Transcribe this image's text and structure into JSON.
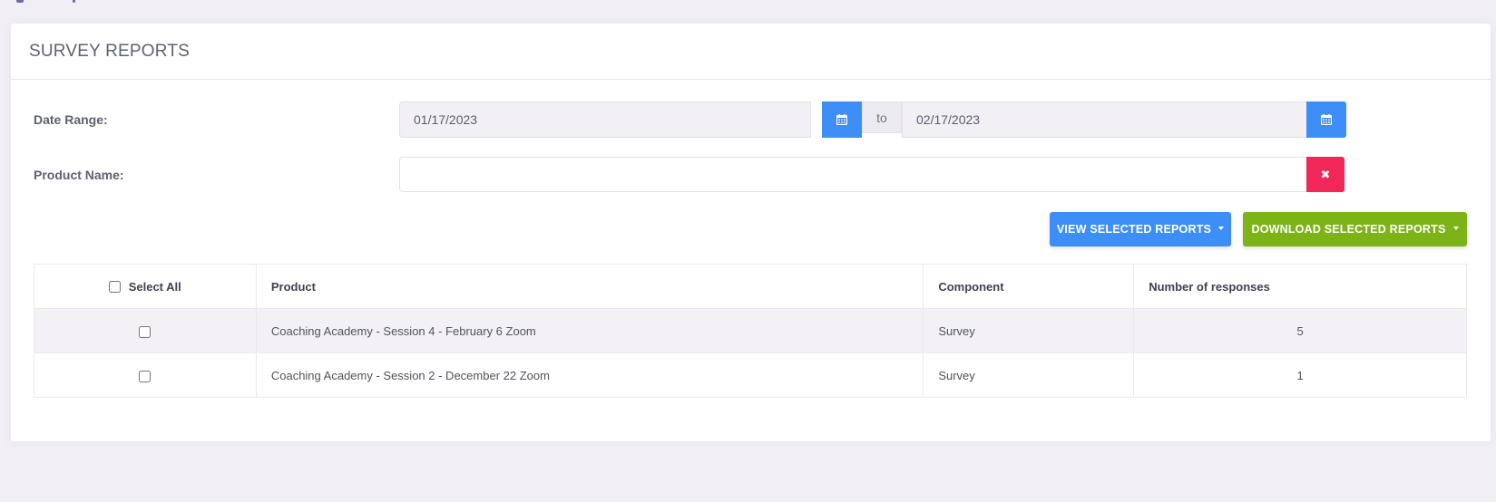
{
  "page": {
    "title": "SURVEY REPORTS"
  },
  "form": {
    "date_range_label": "Date Range:",
    "date_from": "01/17/2023",
    "date_separator": "to",
    "date_to": "02/17/2023",
    "product_name_label": "Product Name:",
    "product_name_value": ""
  },
  "actions": {
    "view_label": "VIEW SELECTED REPORTS",
    "download_label": "DOWNLOAD SELECTED REPORTS"
  },
  "table": {
    "select_all_label": "Select All",
    "columns": [
      "Product",
      "Component",
      "Number of responses"
    ],
    "rows": [
      {
        "product": "Coaching Academy - Session 4 - February 6 Zoom",
        "component": "Survey",
        "responses": "5"
      },
      {
        "product": "Coaching Academy - Session 2 - December 22 Zoom",
        "component": "Survey",
        "responses": "1"
      }
    ]
  },
  "icons": {
    "calendar": "calendar-icon",
    "clear": "times-icon",
    "dropdown": "caret-down-icon"
  },
  "colors": {
    "primary": "#3e8ef7",
    "success": "#7cb316",
    "danger": "#f1275a",
    "background": "#f2eff4"
  }
}
